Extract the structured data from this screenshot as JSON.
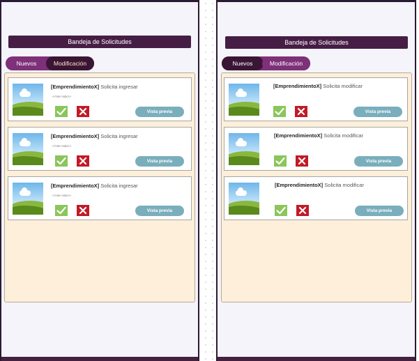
{
  "screens": [
    {
      "header_title": "Bandeja de Solicitudes",
      "tabs": [
        {
          "label": "Nuevos",
          "active": false
        },
        {
          "label": "Modificación",
          "active": true
        }
      ],
      "cards": [
        {
          "tag": "[EmprendimientoX]",
          "action": "Solicita ingresar",
          "see_more": "<<Ver más>>",
          "preview_label": "Vista previa"
        },
        {
          "tag": "[EmprendimientoX]",
          "action": "Solicita ingresar",
          "see_more": "<<Ver más>>",
          "preview_label": "Vista previa"
        },
        {
          "tag": "[EmprendimientoX]",
          "action": "Solicita ingresar",
          "see_more": "<<Ver más>>",
          "preview_label": "Vista previa"
        }
      ]
    },
    {
      "header_title": "Bandeja de Solicitudes",
      "tabs": [
        {
          "label": "Nuevos",
          "active": true
        },
        {
          "label": "Modificación",
          "active": false
        }
      ],
      "cards": [
        {
          "tag": "[EmprendimientoX]",
          "action": "Solicita modificar",
          "preview_label": "Vista previa"
        },
        {
          "tag": "[EmprendimientoX]",
          "action": "Solicita modificar",
          "preview_label": "Vista previa"
        },
        {
          "tag": "[EmprendimientoX]",
          "action": "Solicita modificar",
          "preview_label": "Vista previa"
        }
      ]
    }
  ],
  "colors": {
    "header": "#461d44",
    "tab_bar": "#7e3078",
    "tab_active": "#3a1534",
    "panel": "#fdefd9",
    "approve": "#8ac65a",
    "reject": "#c21a27",
    "preview": "#7aaebc"
  },
  "icons": {
    "approve": "check-icon",
    "reject": "close-icon",
    "thumbnail": "image-placeholder-icon"
  }
}
